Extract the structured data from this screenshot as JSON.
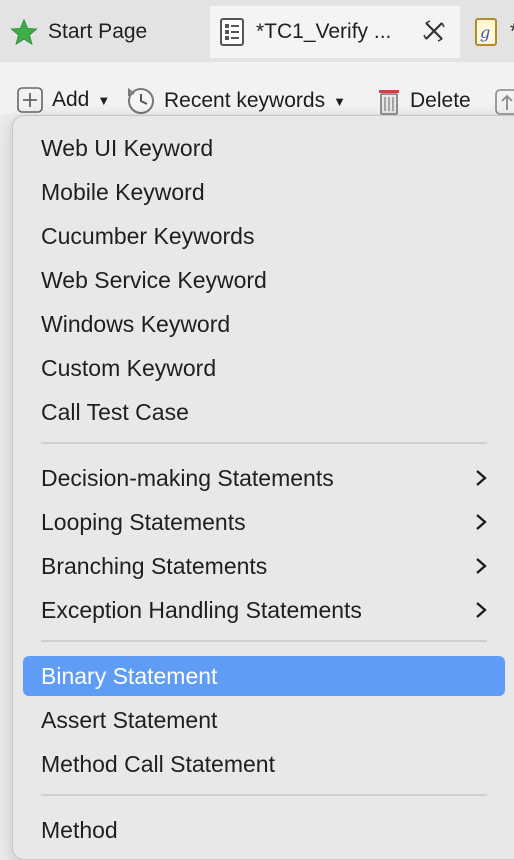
{
  "tabs": [
    {
      "label": "Start Page",
      "icon": "star-icon"
    },
    {
      "label": "*TC1_Verify ...",
      "icon": "test-case-icon"
    },
    {
      "label": "*",
      "icon": "groovy-file-icon"
    }
  ],
  "toolbar": {
    "add_label": "Add",
    "recent_label": "Recent keywords",
    "delete_label": "Delete"
  },
  "menu": {
    "group1": [
      "Web UI Keyword",
      "Mobile Keyword",
      "Cucumber Keywords",
      "Web Service Keyword",
      "Windows Keyword",
      "Custom Keyword",
      "Call Test Case"
    ],
    "group2": [
      "Decision-making Statements",
      "Looping Statements",
      "Branching Statements",
      "Exception Handling Statements"
    ],
    "group3": [
      "Binary Statement",
      "Assert Statement",
      "Method Call Statement"
    ],
    "group4": [
      "Method"
    ],
    "selected": "Binary Statement"
  },
  "colors": {
    "selection": "#5e9cf5",
    "star": "#3fae49"
  }
}
